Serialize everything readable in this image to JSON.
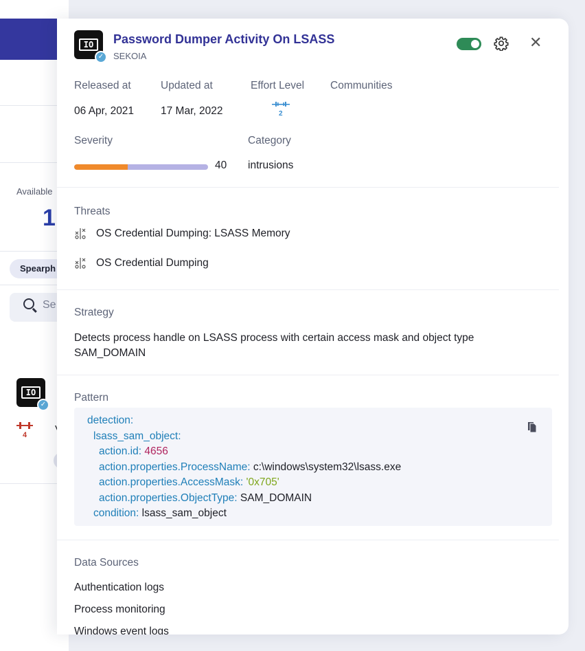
{
  "background": {
    "available_label": "Available",
    "available_count": "1",
    "chip_label": "Spearph",
    "search_placeholder": "Se",
    "effort_value": "4",
    "row_text": "V"
  },
  "header": {
    "title": "Password Dumper Activity On LSASS",
    "vendor": "SEKOIA",
    "enabled": true
  },
  "meta": {
    "released_label": "Released at",
    "released_value": "06 Apr, 2021",
    "updated_label": "Updated at",
    "updated_value": "17 Mar, 2022",
    "effort_label": "Effort Level",
    "effort_value": "2",
    "communities_label": "Communities"
  },
  "severity": {
    "label": "Severity",
    "value": "40",
    "level": 0.4
  },
  "category": {
    "label": "Category",
    "value": "intrusions"
  },
  "threats": {
    "label": "Threats",
    "items": [
      "OS Credential Dumping: LSASS Memory",
      "OS Credential Dumping"
    ]
  },
  "strategy": {
    "label": "Strategy",
    "text": "Detects process handle on LSASS process with certain access mask and object type SAM_DOMAIN"
  },
  "pattern": {
    "label": "Pattern",
    "lines": [
      {
        "key": "detection:",
        "value": ""
      },
      {
        "key": "lsass_sam_object:",
        "value": ""
      },
      {
        "key": "action.id:",
        "value": "4656"
      },
      {
        "key": "action.properties.ProcessName:",
        "value": "c:\\windows\\system32\\lsass.exe"
      },
      {
        "key": "action.properties.AccessMask:",
        "value": "'0x705'"
      },
      {
        "key": "action.properties.ObjectType:",
        "value": "SAM_DOMAIN"
      },
      {
        "key": "condition:",
        "value": "lsass_sam_object"
      }
    ]
  },
  "data_sources": {
    "label": "Data Sources",
    "items": [
      "Authentication logs",
      "Process monitoring",
      "Windows event logs"
    ]
  }
}
